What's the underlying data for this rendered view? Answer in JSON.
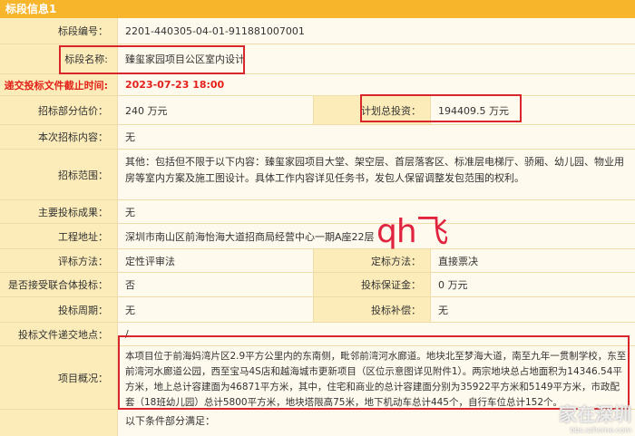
{
  "header": {
    "title": "标段信息1"
  },
  "rows": {
    "bid_no": {
      "label": "标段编号：",
      "value": "2201-440305-04-01-911881007001"
    },
    "bid_name": {
      "label": "标段名称:",
      "value": "臻玺家园项目公区室内设计"
    },
    "deadline": {
      "label": "递交投标文件截止时间:",
      "value": "2023-07-23 18:00"
    },
    "estimate": {
      "label": "招标部分估价：",
      "value": "240 万元",
      "label2": "计划总投资：",
      "value2": "194409.5 万元"
    },
    "content": {
      "label": "本次招标内容：",
      "value": "无"
    },
    "scope": {
      "label": "招标范围：",
      "value": "其他：包括但不限于以下内容：臻玺家园项目大堂、架空层、首层落客区、标准层电梯厅、骄厢、幼儿园、物业用房等室内方案及施工图设计。具体工作内容详见任务书，发包人保留调整发包范围的权利。"
    },
    "results": {
      "label": "主要投标成果：",
      "value": "无"
    },
    "address": {
      "label": "工程地址：",
      "value": "深圳市南山区前海怡海大道招商局经营中心一期A座22层"
    },
    "method": {
      "label": "评标方法：",
      "value": "定性评审法",
      "label2": "定标方法：",
      "value2": "直接票决"
    },
    "consortium": {
      "label": "是否接受联合体投标：",
      "value": "否",
      "label2": "投标保证金：",
      "value2": "0 万元"
    },
    "period": {
      "label": "投标周期：",
      "value": "无",
      "label2": "投标补偿：",
      "value2": "无"
    },
    "location": {
      "label": "投标文件递交地点：",
      "value": "/"
    },
    "overview": {
      "label": "项目概况：",
      "value": "本项目位于前海妈湾片区2.9平方公里内的东南侧，毗邻前湾河水廊道。地块北至梦海大道，南至九年一贯制学校，东至前湾河水廊道公园，西至宝马4S店和越海城市更新项目（区位示意图详见附件1）。两宗地块总占地面积为14346.54平方米，地上总计容建面为46871平方米，其中，住宅和商业的总计容建面分别为35922平方米和5149平方米，市政配套（18班幼儿园）总计5800平方米，地块塔限高75米，地下机动车总计445个，自行车位总计152个。"
    },
    "conditions": {
      "label": "",
      "value": "以下条件部分满足："
    }
  },
  "annotation": {
    "handwriting": "qh飞"
  },
  "watermark": {
    "brand": "家在深圳",
    "url": "bbs.szhome.com"
  },
  "colors": {
    "header": "#f7b52c",
    "label_bg": "#fcecb9",
    "value_bg": "#fffaee",
    "highlight": "#d9262c",
    "deadline": "#e3211b"
  }
}
